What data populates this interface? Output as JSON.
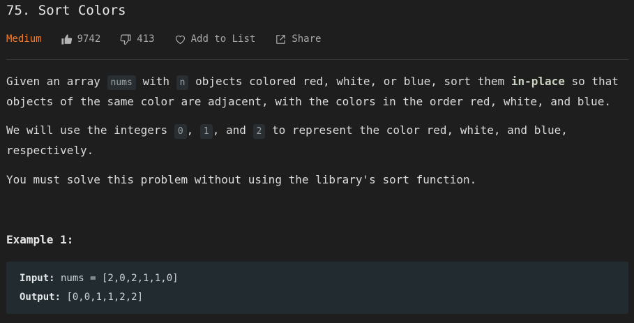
{
  "problem": {
    "title": "75. Sort Colors",
    "difficulty": "Medium",
    "likes": "9742",
    "dislikes": "413",
    "add_to_list": "Add to List",
    "share": "Share"
  },
  "description": {
    "p1": {
      "t1": "Given an array ",
      "c1": "nums",
      "t2": " with ",
      "c2": "n",
      "t3": " objects colored red, white, or blue, sort them ",
      "b1": "in-place",
      "t4": " so that objects of the same color are adjacent, with the colors in the order red, white, and blue."
    },
    "p2": {
      "t1": "We will use the integers ",
      "c1": "0",
      "t2": ", ",
      "c2": "1",
      "t3": ", and ",
      "c3": "2",
      "t4": " to represent the color red, white, and blue, respectively."
    },
    "p3": "You must solve this problem without using the library's sort function."
  },
  "example": {
    "title": "Example 1:",
    "input_label": "Input:",
    "input_value": " nums = [2,0,2,1,1,0]",
    "output_label": "Output:",
    "output_value": " [0,0,1,1,2,2]"
  },
  "colors": {
    "difficulty": "#ef7d2d",
    "background": "#1e1e1e",
    "code_block": "#212b30"
  }
}
